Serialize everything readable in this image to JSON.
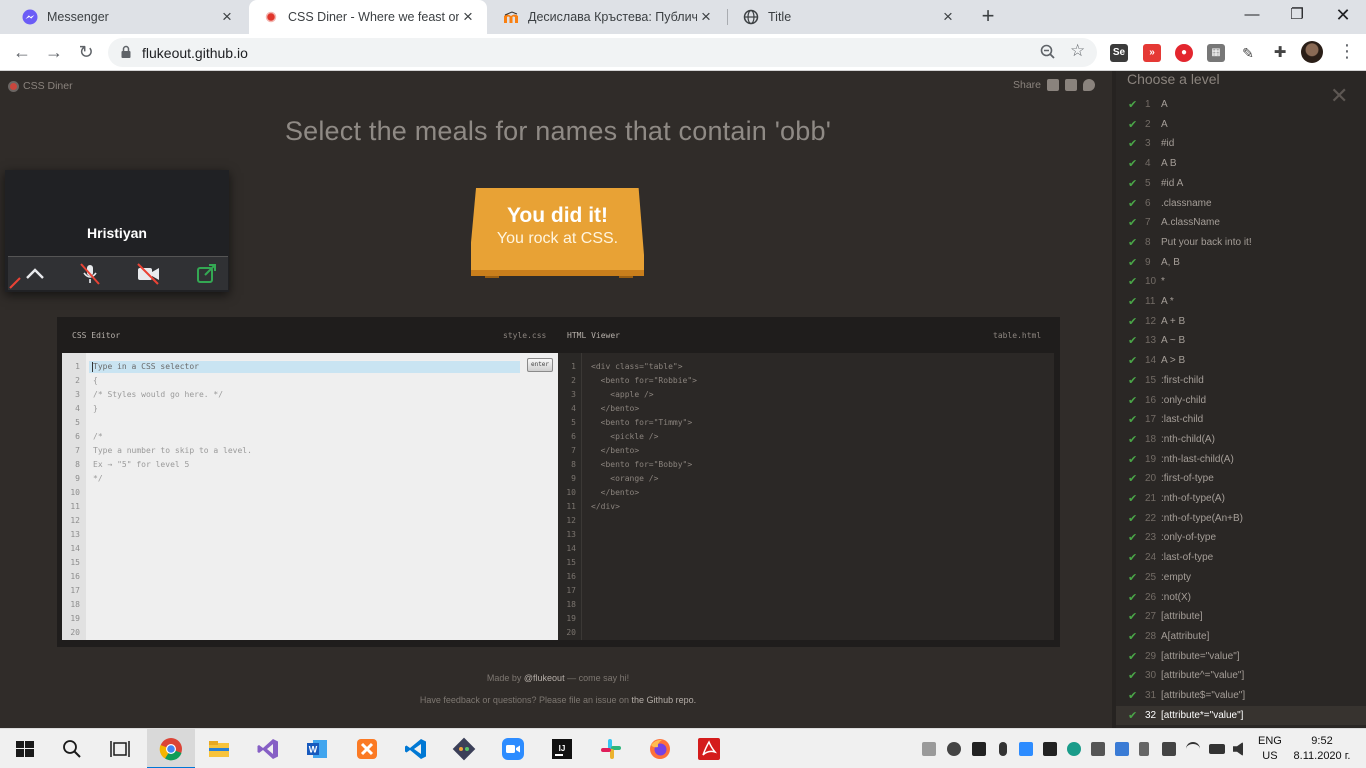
{
  "browser": {
    "tabs": [
      {
        "title": "Messenger",
        "icon": "messenger-icon"
      },
      {
        "title": "CSS Diner - Where we feast on CSS",
        "icon": "css-diner-icon"
      },
      {
        "title": "Десислава Кръстева: Публичен",
        "icon": "moodle-icon"
      },
      {
        "title": "Title",
        "icon": "globe-icon"
      }
    ],
    "url": "flukeout.github.io"
  },
  "site": {
    "logo_text": "CSS Diner",
    "share_label": "Share"
  },
  "level": {
    "instruction": "Select the meals for names that contain 'obb'",
    "success_title": "You did it!",
    "success_subtitle": "You rock at CSS."
  },
  "call": {
    "participant_name": "Hristiyan"
  },
  "css_editor": {
    "title": "CSS Editor",
    "file": "style.css",
    "placeholder": "Type in a CSS selector",
    "enter_label": "enter",
    "lines": [
      "",
      "{",
      "/* Styles would go here. */",
      "}",
      "",
      "/*",
      "Type a number to skip to a level.",
      "Ex → \"5\" for level 5",
      "*/",
      "",
      "",
      "",
      "",
      "",
      "",
      "",
      "",
      "",
      "",
      ""
    ]
  },
  "html_viewer": {
    "title": "HTML Viewer",
    "file": "table.html",
    "lines": [
      "<div class=\"table\">",
      "  <bento for=\"Robbie\">",
      "    <apple />",
      "  </bento>",
      "  <bento for=\"Timmy\">",
      "    <pickle />",
      "  </bento>",
      "  <bento for=\"Bobby\">",
      "    <orange />",
      "  </bento>",
      "</div>",
      "",
      "",
      "",
      "",
      "",
      "",
      "",
      "",
      ""
    ]
  },
  "footer": {
    "made_by_prefix": "Made by",
    "made_by_link": "@flukeout",
    "made_by_suffix": "— come say hi!",
    "feedback_prefix": "Have feedback or questions? Please file an issue on",
    "feedback_link": "the Github repo."
  },
  "levels_panel": {
    "heading": "Choose a level",
    "current_level": 32,
    "levels": [
      {
        "num": "1",
        "selector": "A"
      },
      {
        "num": "2",
        "selector": "A"
      },
      {
        "num": "3",
        "selector": "#id"
      },
      {
        "num": "4",
        "selector": "A B"
      },
      {
        "num": "5",
        "selector": "#id A"
      },
      {
        "num": "6",
        "selector": ".classname"
      },
      {
        "num": "7",
        "selector": "A.className"
      },
      {
        "num": "8",
        "selector": "Put your back into it!"
      },
      {
        "num": "9",
        "selector": "A, B"
      },
      {
        "num": "10",
        "selector": "*"
      },
      {
        "num": "11",
        "selector": "A *"
      },
      {
        "num": "12",
        "selector": "A + B"
      },
      {
        "num": "13",
        "selector": "A ~ B"
      },
      {
        "num": "14",
        "selector": "A > B"
      },
      {
        "num": "15",
        "selector": ":first-child"
      },
      {
        "num": "16",
        "selector": ":only-child"
      },
      {
        "num": "17",
        "selector": ":last-child"
      },
      {
        "num": "18",
        "selector": ":nth-child(A)"
      },
      {
        "num": "19",
        "selector": ":nth-last-child(A)"
      },
      {
        "num": "20",
        "selector": ":first-of-type"
      },
      {
        "num": "21",
        "selector": ":nth-of-type(A)"
      },
      {
        "num": "22",
        "selector": ":nth-of-type(An+B)"
      },
      {
        "num": "23",
        "selector": ":only-of-type"
      },
      {
        "num": "24",
        "selector": ":last-of-type"
      },
      {
        "num": "25",
        "selector": ":empty"
      },
      {
        "num": "26",
        "selector": ":not(X)"
      },
      {
        "num": "27",
        "selector": "[attribute]"
      },
      {
        "num": "28",
        "selector": "A[attribute]"
      },
      {
        "num": "29",
        "selector": "[attribute=\"value\"]"
      },
      {
        "num": "30",
        "selector": "[attribute^=\"value\"]"
      },
      {
        "num": "31",
        "selector": "[attribute$=\"value\"]"
      },
      {
        "num": "32",
        "selector": "[attribute*=\"value\"]"
      }
    ]
  },
  "taskbar": {
    "language_line1": "ENG",
    "language_line2": "US",
    "time": "9:52",
    "date": "8.11.2020 г."
  },
  "colors": {
    "page_bg": "#302c29",
    "table_orange": "#e8a235",
    "check_green": "#4aa648"
  }
}
